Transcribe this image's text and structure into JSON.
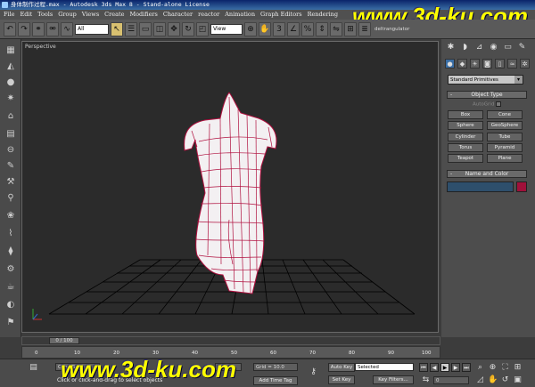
{
  "window": {
    "title": "身体制作过程.max - Autodesk 3ds Max 8 - Stand-alone License"
  },
  "watermark": "www.3d-ku.com",
  "menu": [
    "File",
    "Edit",
    "Tools",
    "Group",
    "Views",
    "Create",
    "Modifiers",
    "Character",
    "reactor",
    "Animation",
    "Graph Editors",
    "Rendering"
  ],
  "toolbar": {
    "selection_filter": "All",
    "reference_coord": "View",
    "right_label": "deltrangulator"
  },
  "viewport": {
    "label": "Perspective"
  },
  "command_panel": {
    "primitive_type": "Standard Primitives",
    "object_type_title": "Object Type",
    "autogrid_label": "AutoGrid",
    "buttons": [
      "Box",
      "Cone",
      "Sphere",
      "GeoSphere",
      "Cylinder",
      "Tube",
      "Torus",
      "Pyramid",
      "Teapot",
      "Plane"
    ],
    "name_color_title": "Name and Color",
    "object_color": "#a0103a"
  },
  "timeline": {
    "frame_display": "0 / 100",
    "ticks": [
      "0",
      "10",
      "20",
      "30",
      "40",
      "50",
      "60",
      "70",
      "80",
      "90",
      "100"
    ]
  },
  "status": {
    "object_label": "Cone S",
    "prompt": "Click or click-and-drag to select objects",
    "z_label": "Z:",
    "z_value": "0.0",
    "grid": "Grid = 10.0",
    "add_time_tag": "Add Time Tag",
    "auto_key": "Auto Key",
    "selected": "Selected",
    "set_key": "Set Key",
    "key_filters": "Key Filters...",
    "frame_field": "0"
  }
}
